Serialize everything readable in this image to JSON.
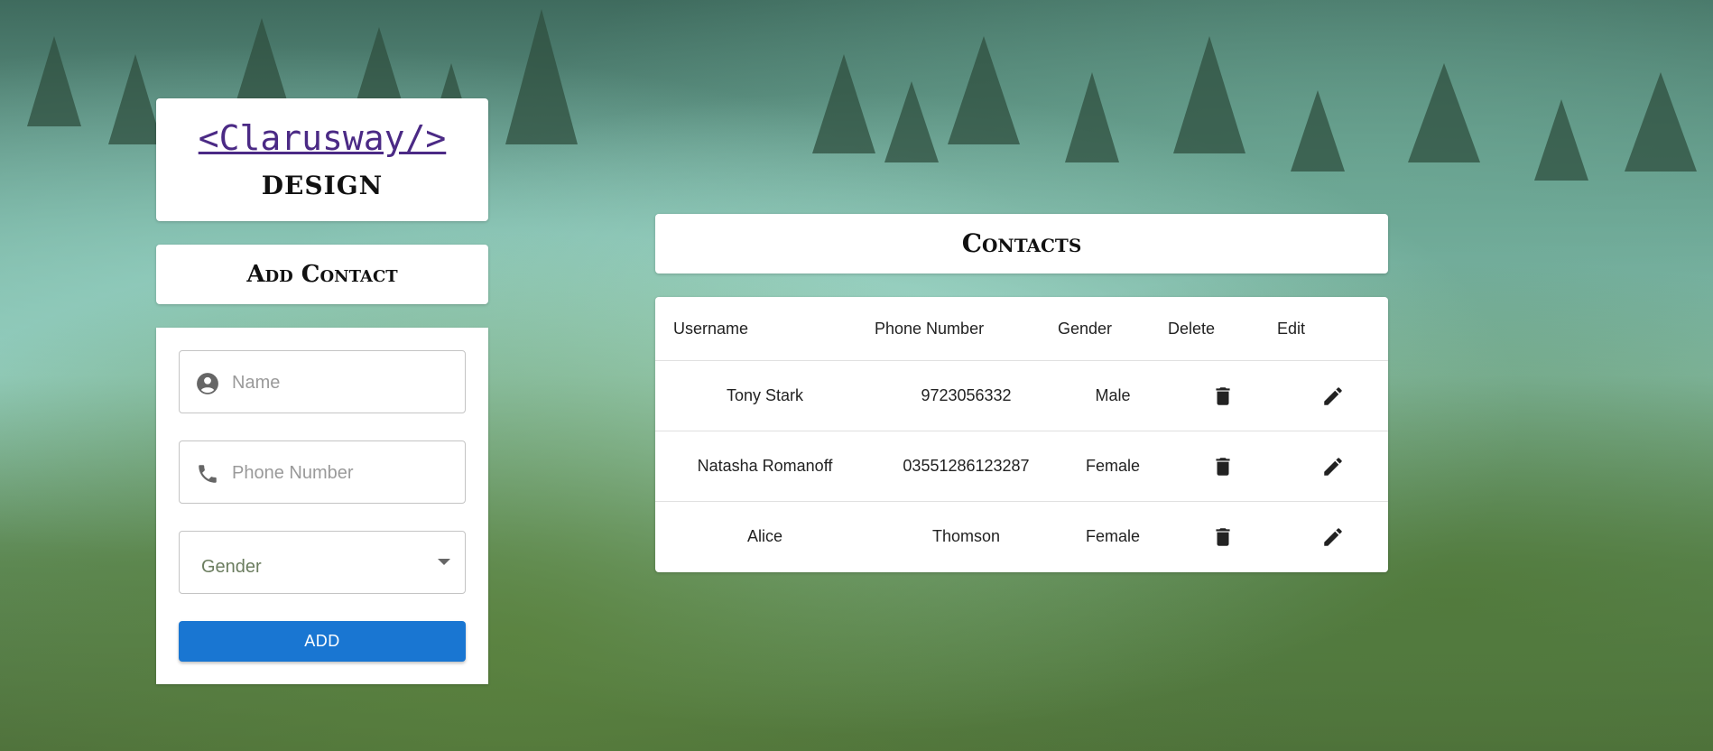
{
  "brand": {
    "logo_text": "<Clarusway/>",
    "subtitle": "DESIGN"
  },
  "add_contact": {
    "title": "Add Contact",
    "name_placeholder": "Name",
    "phone_placeholder": "Phone Number",
    "gender_label": "Gender",
    "add_button_label": "ADD"
  },
  "contacts": {
    "title": "Contacts",
    "headers": {
      "username": "Username",
      "phone": "Phone Number",
      "gender": "Gender",
      "delete": "Delete",
      "edit": "Edit"
    },
    "rows": [
      {
        "username": "Tony Stark",
        "phone": "9723056332",
        "gender": "Male"
      },
      {
        "username": "Natasha Romanoff",
        "phone": "03551286123287",
        "gender": "Female"
      },
      {
        "username": "Alice",
        "phone": "Thomson",
        "gender": "Female"
      }
    ]
  },
  "colors": {
    "primary_button": "#1976d2",
    "logo_link": "#4b2a85"
  },
  "icons": {
    "name_field": "account-circle-icon",
    "phone_field": "phone-icon",
    "gender_field": "chevron-down-icon",
    "delete": "trash-icon",
    "edit": "pencil-icon"
  }
}
